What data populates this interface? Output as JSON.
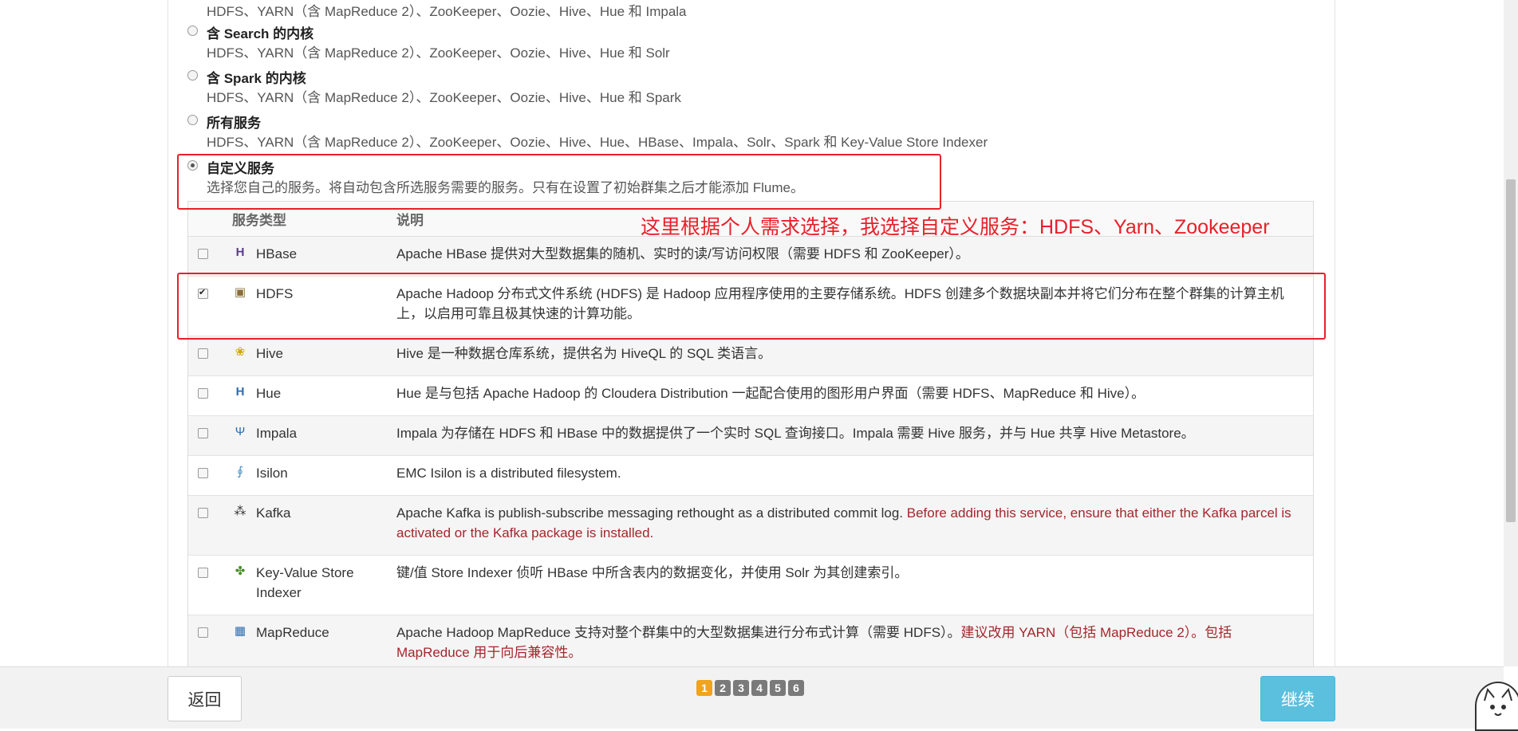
{
  "options": [
    {
      "title": "",
      "desc": "HDFS、YARN（含 MapReduce 2）、ZooKeeper、Oozie、Hive、Hue 和 Impala"
    },
    {
      "title": "含 Search 的内核",
      "desc": "HDFS、YARN（含 MapReduce 2）、ZooKeeper、Oozie、Hive、Hue 和 Solr"
    },
    {
      "title": "含 Spark 的内核",
      "desc": "HDFS、YARN（含 MapReduce 2）、ZooKeeper、Oozie、Hive、Hue 和 Spark"
    },
    {
      "title": "所有服务",
      "desc": "HDFS、YARN（含 MapReduce 2）、ZooKeeper、Oozie、Hive、Hue、HBase、Impala、Solr、Spark 和 Key-Value Store Indexer"
    },
    {
      "title": "自定义服务",
      "desc": "选择您自己的服务。将自动包含所选服务需要的服务。只有在设置了初始群集之后才能添加 Flume。",
      "selected": true
    }
  ],
  "table": {
    "headers": {
      "type": "服务类型",
      "desc": "说明"
    },
    "rows": [
      {
        "name": "HBase",
        "icon": "hbase-icon",
        "checked": false,
        "desc": "Apache HBase 提供对大型数据集的随机、实时的读/写访问权限（需要 HDFS 和 ZooKeeper）。"
      },
      {
        "name": "HDFS",
        "icon": "hdfs-icon",
        "checked": true,
        "desc": "Apache Hadoop 分布式文件系统 (HDFS) 是 Hadoop 应用程序使用的主要存储系统。HDFS 创建多个数据块副本并将它们分布在整个群集的计算主机上，以启用可靠且极其快速的计算功能。"
      },
      {
        "name": "Hive",
        "icon": "hive-icon",
        "checked": false,
        "desc": "Hive 是一种数据仓库系统，提供名为 HiveQL 的 SQL 类语言。"
      },
      {
        "name": "Hue",
        "icon": "hue-icon",
        "checked": false,
        "desc": "Hue 是与包括 Apache Hadoop 的 Cloudera Distribution 一起配合使用的图形用户界面（需要 HDFS、MapReduce 和 Hive）。"
      },
      {
        "name": "Impala",
        "icon": "impala-icon",
        "checked": false,
        "desc": "Impala 为存储在 HDFS 和 HBase 中的数据提供了一个实时 SQL 查询接口。Impala 需要 Hive 服务，并与 Hue 共享 Hive Metastore。"
      },
      {
        "name": "Isilon",
        "icon": "isilon-icon",
        "checked": false,
        "desc": "EMC Isilon is a distributed filesystem."
      },
      {
        "name": "Kafka",
        "icon": "kafka-icon",
        "checked": false,
        "desc": "Apache Kafka is publish-subscribe messaging rethought as a distributed commit log. ",
        "warn": "Before adding this service, ensure that either the Kafka parcel is activated or the Kafka package is installed."
      },
      {
        "name": "Key-Value Store Indexer",
        "icon": "key-value-indexer-icon",
        "checked": false,
        "desc": "键/值 Store Indexer 侦听 HBase 中所含表内的数据变化，并使用 Solr 为其创建索引。"
      },
      {
        "name": "MapReduce",
        "icon": "mapreduce-icon",
        "checked": false,
        "desc": "Apache Hadoop MapReduce 支持对整个群集中的大型数据集进行分布式计算（需要 HDFS）。",
        "warn": "建议改用 YARN（包括 MapReduce 2）。包括 MapReduce 用于向后兼容性。"
      }
    ]
  },
  "annotation": "这里根据个人需求选择，我选择自定义服务：HDFS、Yarn、Zookeeper",
  "footer": {
    "back_label": "返回",
    "next_label": "继续",
    "pages": [
      "1",
      "2",
      "3",
      "4",
      "5",
      "6"
    ],
    "active_page": "1"
  },
  "colors": {
    "accent_red": "#e8202a",
    "primary_button": "#5bc0de",
    "active_page": "#f0a31e",
    "warning_text": "#a5262d"
  }
}
